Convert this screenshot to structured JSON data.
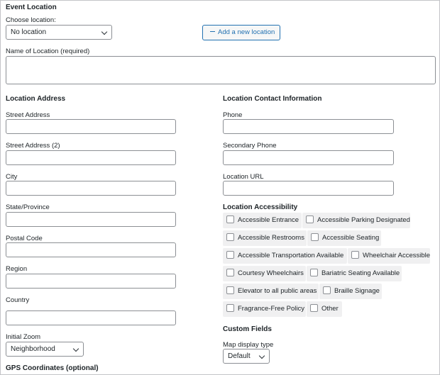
{
  "section_title": "Event Location",
  "choose_location": {
    "label": "Choose location:",
    "selected": "No location"
  },
  "add_location_button": "Add a new location",
  "name_of_location": {
    "label": "Name of Location (required)",
    "value": ""
  },
  "address": {
    "heading": "Location Address",
    "fields": [
      {
        "label": "Street Address",
        "value": ""
      },
      {
        "label": "Street Address (2)",
        "value": ""
      },
      {
        "label": "City",
        "value": ""
      },
      {
        "label": "State/Province",
        "value": ""
      },
      {
        "label": "Postal Code",
        "value": ""
      },
      {
        "label": "Region",
        "value": ""
      },
      {
        "label": "Country",
        "value": ""
      }
    ],
    "initial_zoom": {
      "label": "Initial Zoom",
      "selected": "Neighborhood"
    },
    "gps_heading": "GPS Coordinates (optional)"
  },
  "contact": {
    "heading": "Location Contact Information",
    "fields": [
      {
        "label": "Phone",
        "value": ""
      },
      {
        "label": "Secondary Phone",
        "value": ""
      },
      {
        "label": "Location URL",
        "value": ""
      }
    ]
  },
  "accessibility": {
    "heading": "Location Accessibility",
    "options": [
      {
        "label": "Accessible Entrance",
        "checked": false
      },
      {
        "label": "Accessible Parking Designated",
        "checked": false
      },
      {
        "label": "Accessible Restrooms",
        "checked": false
      },
      {
        "label": "Accessible Seating",
        "checked": false
      },
      {
        "label": "Accessible Transportation Available",
        "checked": false
      },
      {
        "label": "Wheelchair Accessible",
        "checked": false
      },
      {
        "label": "Courtesy Wheelchairs",
        "checked": false
      },
      {
        "label": "Bariatric Seating Available",
        "checked": false
      },
      {
        "label": "Elevator to all public areas",
        "checked": false
      },
      {
        "label": "Braille Signage",
        "checked": false
      },
      {
        "label": "Fragrance-Free Policy",
        "checked": false
      },
      {
        "label": "Other",
        "checked": false
      }
    ]
  },
  "custom_fields": {
    "heading": "Custom Fields",
    "map_display_type": {
      "label": "Map display type",
      "selected": "Default"
    }
  },
  "colors": {
    "accent": "#2271b1",
    "border": "#8c8f94",
    "chip_bg": "#f0f0f1"
  }
}
